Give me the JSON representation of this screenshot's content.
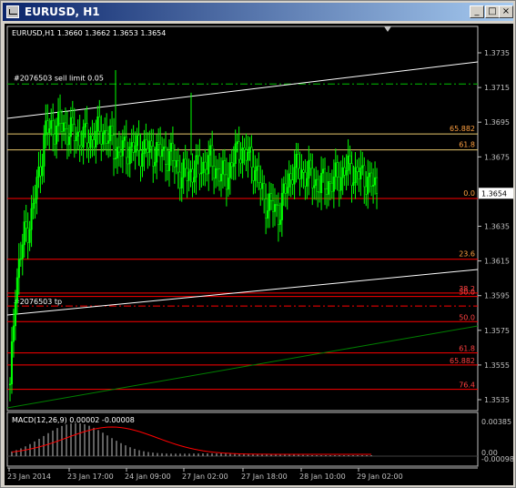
{
  "window": {
    "title": "EURUSD, H1"
  },
  "buttons": {
    "minimize": "_",
    "maximize": "□",
    "close": "×"
  },
  "chart_data": {
    "type": "candlestick",
    "symbol_header": "EURUSD,H1  1.3660  1.3662  1.3653  1.3654",
    "current_price": "1.3654",
    "price_axis_ticks": [
      "1.3735",
      "1.3715",
      "1.3695",
      "1.3675",
      "1.3654",
      "1.3635",
      "1.3615",
      "1.3595",
      "1.3575",
      "1.3555",
      "1.3535"
    ],
    "time_axis_ticks": [
      "23 Jan 2014",
      "23 Jan 17:00",
      "24 Jan 09:00",
      "27 Jan 02:00",
      "27 Jan 18:00",
      "28 Jan 10:00",
      "29 Jan 02:00"
    ],
    "order_labels": {
      "sell_limit": "#2076503 sell limit 0.05",
      "tp": "#2076503 tp"
    },
    "fib_set_1": [
      "65.882",
      "61.8",
      "0.0",
      "23.6"
    ],
    "fib_set_2": [
      "38.2",
      "50.0",
      "50.0",
      "61.8",
      "65.882",
      "76.4"
    ],
    "macd": {
      "label": "MACD(12,26,9) 0.00002 -0.00008",
      "axis_ticks": [
        "0.00385",
        "0.00",
        "-0.00098"
      ]
    },
    "colors": {
      "background": "#000000",
      "bull": "#00ff00",
      "bear": "#00ff00",
      "fib": "#ff0000",
      "fib_text_1": "#ffa040",
      "fib_text_2": "#ff4040",
      "order_line": "#00c000",
      "trendline": "#ffffff",
      "ma_line": "#008000",
      "macd_hist": "#c0c0c0",
      "macd_signal": "#ff0000"
    }
  }
}
